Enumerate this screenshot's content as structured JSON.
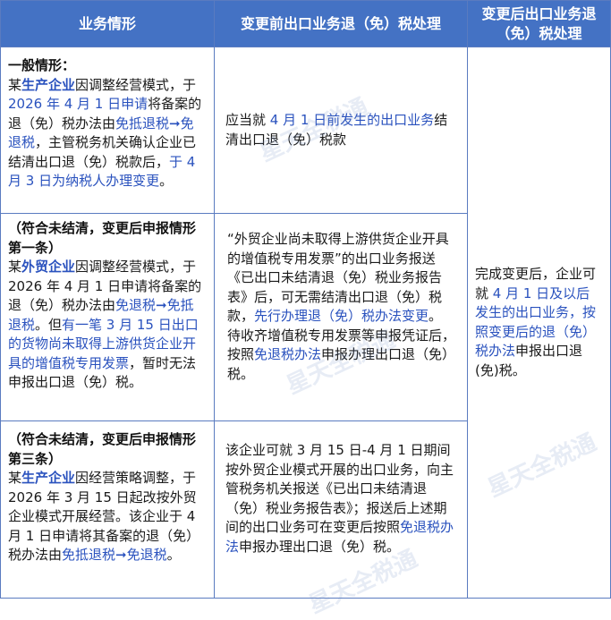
{
  "header": {
    "col1": "业务情形",
    "col2": "变更前出口业务退（免）税处理",
    "col3": "变更后出口业务退（免）税处理"
  },
  "rows": [
    {
      "left": [
        {
          "t": "一般情形：",
          "s": "b"
        },
        {
          "t": "某",
          "s": ""
        },
        {
          "t": "生产企业",
          "s": "blue-b"
        },
        {
          "t": "因调整经营模式，于",
          "s": ""
        },
        {
          "t": "2026 年 4 月 1 日申请",
          "s": "blue"
        },
        {
          "t": "将备案的退（免）税办法由",
          "s": ""
        },
        {
          "t": "免抵退税➞免退税",
          "s": "blue"
        },
        {
          "t": "，主管税务机关确认企业已结清出口退（免）税款后，",
          "s": ""
        },
        {
          "t": "于 4 月 3 日为纳税人办理变更",
          "s": "blue"
        },
        {
          "t": "。",
          "s": ""
        }
      ],
      "mid": [
        {
          "t": "应当就",
          "s": ""
        },
        {
          "t": " 4 月 1 日前发生的出口业务",
          "s": "blue"
        },
        {
          "t": "结清出口退（免）税款",
          "s": ""
        }
      ]
    },
    {
      "left": [
        {
          "t": "（符合未结清，变更后申报情形第一条）",
          "s": "b"
        },
        {
          "t": "某",
          "s": ""
        },
        {
          "t": "外贸企业",
          "s": "blue-b"
        },
        {
          "t": "因调整经营模式，于 2026 年 4 月 1 日申请将备案的退（免）税办法由",
          "s": ""
        },
        {
          "t": "免退税➞免抵退税",
          "s": "blue"
        },
        {
          "t": "。但",
          "s": ""
        },
        {
          "t": "有一笔 3 月 15 日出口的货物尚未取得上游供货企业开具的增值税专用发票",
          "s": "blue"
        },
        {
          "t": "，暂时无法申报出口退（免）税。",
          "s": ""
        }
      ],
      "mid": [
        {
          "t": "“外贸企业尚未取得上游供货企业开具的增值税专用发票”的出口业务报送《已出口未结清退（免）税业务报告表》后，可无需结清出口退（免）税款，",
          "s": ""
        },
        {
          "t": "先行办理退（免）税办法变更",
          "s": "blue"
        },
        {
          "t": "。",
          "s": ""
        },
        {
          "t": "待收齐增值税专用发票等申报凭证后，按照",
          "s": ""
        },
        {
          "t": "免退税办法",
          "s": "blue"
        },
        {
          "t": "申报办理出口退（免）税。",
          "s": ""
        }
      ]
    },
    {
      "left": [
        {
          "t": "（符合未结清，变更后申报情形第三条）",
          "s": "b"
        },
        {
          "t": "某",
          "s": ""
        },
        {
          "t": "生产企业",
          "s": "blue-b"
        },
        {
          "t": "因经营策略调整，于 2026 年 3 月 15 日起改按外贸企业模式开展经营。该企业于 4 月 1 日申请将其备案的退（免）税办法由",
          "s": ""
        },
        {
          "t": "免抵退税➞免退税",
          "s": "blue"
        },
        {
          "t": "。",
          "s": ""
        }
      ],
      "mid": [
        {
          "t": "该企业可就 3 月 15 日-4 月 1 日期间按外贸企业模式开展的出口业务，向主管税务机关报送《已出口未结清退（免）税业务报告表》；报送后上述期间的出口业务可在变更后按照",
          "s": ""
        },
        {
          "t": "免退税办法",
          "s": "blue"
        },
        {
          "t": "申报办理出口退（免）税。",
          "s": ""
        }
      ]
    }
  ],
  "right": [
    {
      "t": "完成变更后，企业可就",
      "s": ""
    },
    {
      "t": " 4 月 1 日及以后发生的出口业务，按照变更后的退（免）税办法",
      "s": "blue"
    },
    {
      "t": "申报出口退(免)税。",
      "s": ""
    }
  ],
  "watermark_text": "星天全税通"
}
